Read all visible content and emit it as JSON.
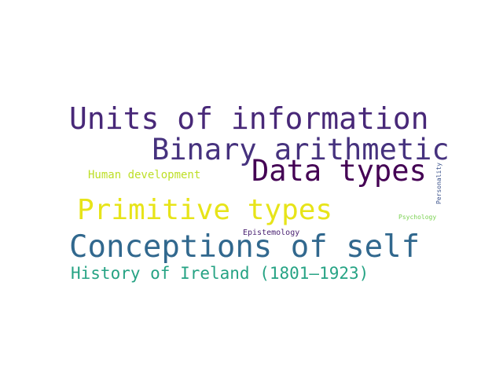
{
  "word_cloud": {
    "words": [
      {
        "text": "Units of information",
        "color": "#482878"
      },
      {
        "text": "Binary arithmetic",
        "color": "#46327e"
      },
      {
        "text": "Data types",
        "color": "#440154"
      },
      {
        "text": "Human development",
        "color": "#bddf26"
      },
      {
        "text": "Primitive types",
        "color": "#e7e419"
      },
      {
        "text": "Personality",
        "color": "#3b528b"
      },
      {
        "text": "Psychology",
        "color": "#7ad151"
      },
      {
        "text": "Epistemology",
        "color": "#481f70"
      },
      {
        "text": "Conceptions of self",
        "color": "#31688e"
      },
      {
        "text": "History of Ireland (1801–1923)",
        "color": "#26a384"
      }
    ]
  }
}
